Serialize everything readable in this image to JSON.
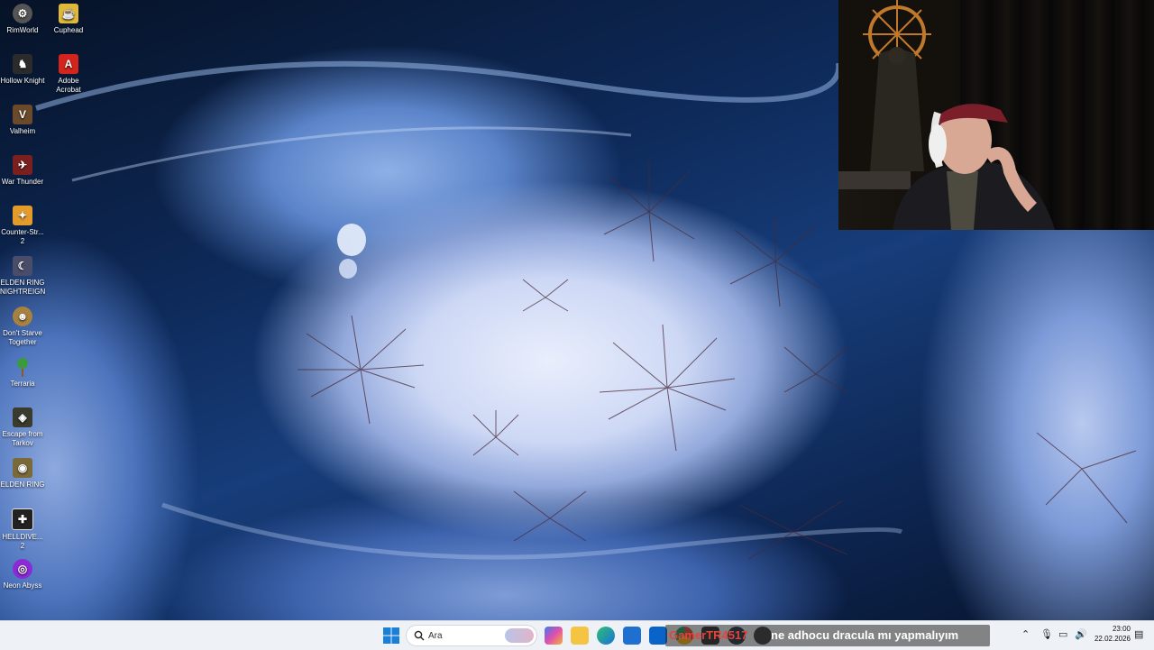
{
  "desktop": {
    "icons": [
      {
        "label": "RimWorld",
        "color": "#6b6b6b"
      },
      {
        "label": "Cuphead",
        "color": "#e0b93a"
      },
      {
        "label": "Hollow Knight",
        "color": "#2b2b2b"
      },
      {
        "label": "Adobe Acrobat",
        "color": "#d4241b"
      },
      {
        "label": "Valheim",
        "color": "#6a4a2a"
      },
      {
        "label": "War Thunder",
        "color": "#7c1f1f"
      },
      {
        "label": "Counter-Str... 2",
        "color": "#e39b2c"
      },
      {
        "label": "ELDEN RING NIGHTREIGN",
        "color": "#4a4d6a"
      },
      {
        "label": "Don't Starve Together",
        "color": "#a6813f"
      },
      {
        "label": "Terraria",
        "color": "#3b9a3b"
      },
      {
        "label": "Escape from Tarkov",
        "color": "#3a3a2e"
      },
      {
        "label": "ELDEN RING",
        "color": "#7a6a3a"
      },
      {
        "label": "HELLDIVE... 2",
        "color": "#222222"
      },
      {
        "label": "Neon Abyss",
        "color": "#8a2bd6"
      }
    ]
  },
  "taskbar": {
    "search_placeholder": "Ara",
    "apps": [
      "copilot-app",
      "file-explorer",
      "edge-browser",
      "microsoft-store",
      "outlook",
      "chrome",
      "epic-games",
      "steam",
      "obs"
    ]
  },
  "chat_overlay": {
    "username": "GamerTR4517",
    "message": "ne adhocu dracula mı yapmalıyım"
  },
  "clock": {
    "time": "23:00",
    "date": "22.02.2026"
  }
}
